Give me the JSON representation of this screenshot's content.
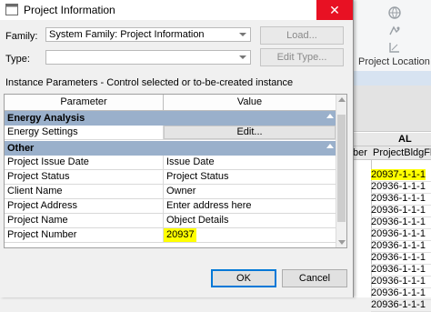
{
  "dialog": {
    "title": "Project Information",
    "close_glyph": "✕",
    "family_label": "Family:",
    "family_value": "System Family: Project Information",
    "type_label": "Type:",
    "type_value": "",
    "load_label": "Load...",
    "edit_type_label": "Edit Type...",
    "instance_caption": "Instance Parameters - Control selected or to-be-created instance",
    "ok_label": "OK",
    "cancel_label": "Cancel"
  },
  "grid": {
    "col_parameter": "Parameter",
    "col_value": "Value",
    "groups": [
      {
        "name": "Energy Analysis"
      },
      {
        "name": "Other"
      }
    ],
    "energy_rows": [
      {
        "param": "Energy Settings",
        "value": "Edit..."
      }
    ],
    "other_rows": [
      {
        "param": "Project Issue Date",
        "value": "Issue Date"
      },
      {
        "param": "Project Status",
        "value": "Project Status"
      },
      {
        "param": "Client Name",
        "value": "Owner"
      },
      {
        "param": "Project Address",
        "value": "Enter address here"
      },
      {
        "param": "Project Name",
        "value": "Object Details"
      },
      {
        "param": "Project Number",
        "value": "20937"
      }
    ]
  },
  "background": {
    "ribbon_label": "Project Location",
    "col_letter": "AL",
    "col_left_header": "ber",
    "col_header": "ProjectBldgFloor",
    "rows": [
      "20937-1-1-1",
      "20936-1-1-1",
      "20936-1-1-1",
      "20936-1-1-1",
      "20936-1-1-1",
      "20936-1-1-1",
      "20936-1-1-1",
      "20936-1-1-1",
      "20936-1-1-1",
      "20936-1-1-1",
      "20936-1-1-1",
      "20936-1-1-1"
    ],
    "highlight_color": "#ffff00"
  },
  "colors": {
    "group_header": "#9ab0cb",
    "close_button": "#e81123",
    "primary_border": "#0078d7"
  }
}
